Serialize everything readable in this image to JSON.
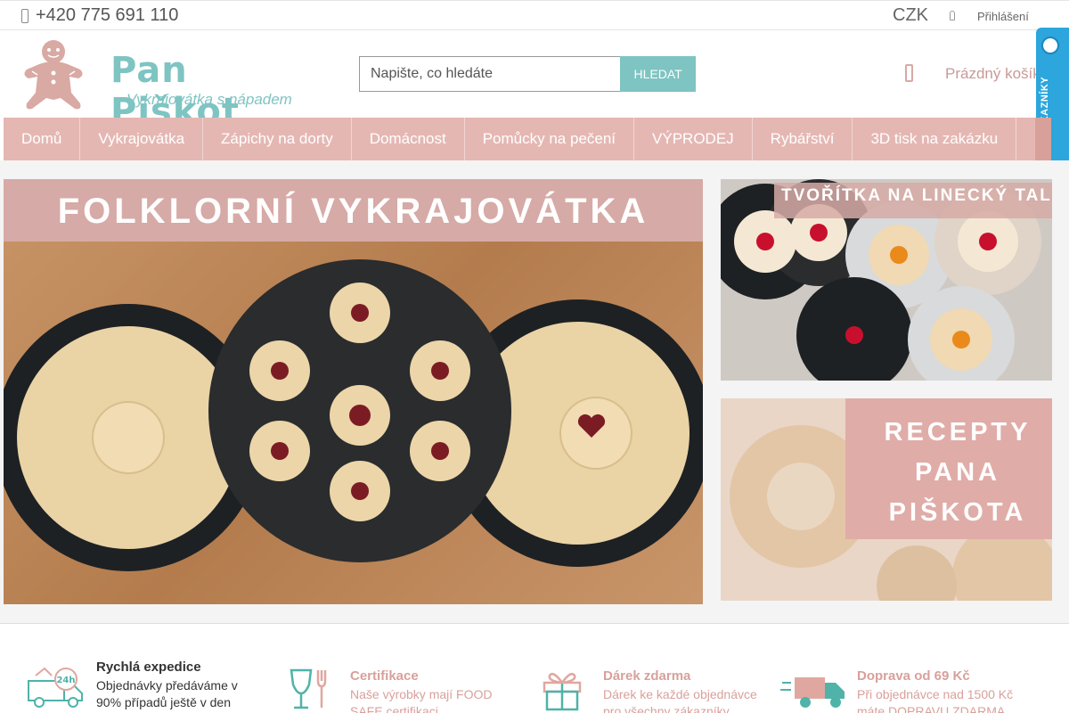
{
  "topbar": {
    "phone": "+420 775 691 110",
    "currency": "CZK",
    "login": "Přihlášení"
  },
  "header": {
    "logo_name": "Pan Piškot",
    "logo_tagline": "Vykrajovátka s nápadem",
    "search_placeholder": "Napište, co hledáte",
    "search_button": "HLEDAT",
    "cart_label": "Prázdný košík",
    "badge_text": "OVĚŘENO ZÁKAZNÍKY"
  },
  "nav": {
    "items": [
      "Domů",
      "Vykrajovátka",
      "Zápichy na dorty",
      "Domácnost",
      "Pomůcky na pečení",
      "VÝPRODEJ",
      "Rybářství",
      "3D tisk na zakázku"
    ]
  },
  "banners": {
    "main_title": "FOLKLORNÍ VYKRAJOVÁTKA",
    "top_title": "TVOŘÍTKA NA LINECKÝ TALÍŘ",
    "bottom_title": "RECEPTY PANA PIŠKOTA"
  },
  "features": [
    {
      "icon": "delivery-24h-icon",
      "title": "Rychlá expedice",
      "desc": "Objednávky předáváme v 90% případů ještě v den"
    },
    {
      "icon": "food-safe-icon",
      "title": "Certifikace",
      "desc": "Naše výrobky mají FOOD SAFE certifikaci"
    },
    {
      "icon": "gift-icon",
      "title": "Dárek zdarma",
      "desc": "Dárek ke každé objednávce pro všechny zákazníky"
    },
    {
      "icon": "truck-icon",
      "title": "Doprava od 69 Kč",
      "desc": "Při objednávce nad 1500 Kč máte DOPRAVU ZDARMA"
    }
  ],
  "colors": {
    "accent_teal": "#7ec4c2",
    "nav_pink": "#e5b7b3",
    "badge_blue": "#2ca6dc"
  }
}
